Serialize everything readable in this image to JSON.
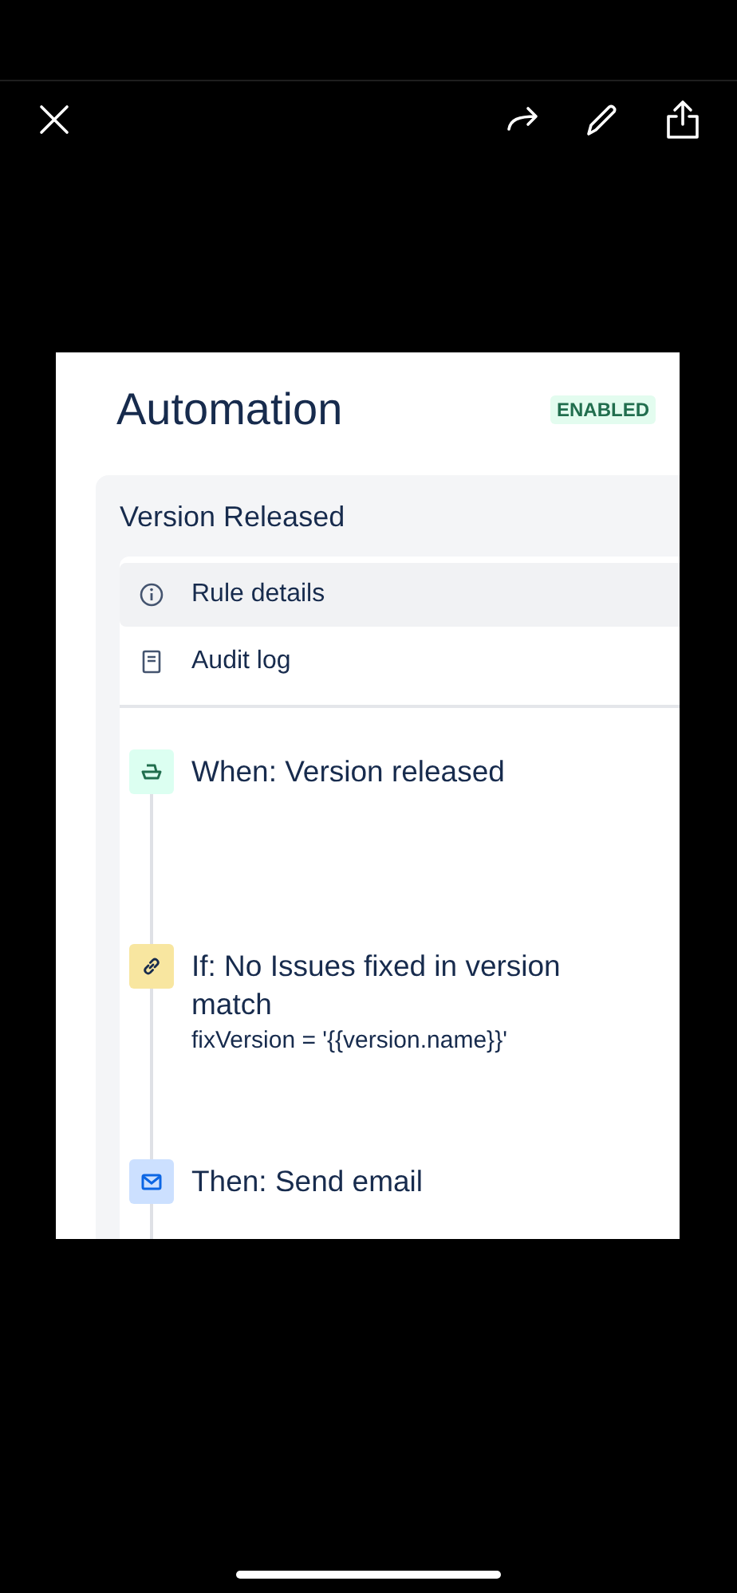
{
  "screenshot": {
    "title": "Automation",
    "status": "ENABLED",
    "rule": {
      "name": "Version Released",
      "menu": [
        {
          "label": "Rule details",
          "kind": "info",
          "selected": true
        },
        {
          "label": "Audit log",
          "kind": "log",
          "selected": false
        }
      ],
      "steps": [
        {
          "kind": "trigger",
          "title": "When: Version released"
        },
        {
          "kind": "condition",
          "title": "If: No Issues fixed in version match",
          "detail": "fixVersion = '{{version.name}}'"
        },
        {
          "kind": "action",
          "title": "Then: Send email"
        }
      ]
    }
  }
}
